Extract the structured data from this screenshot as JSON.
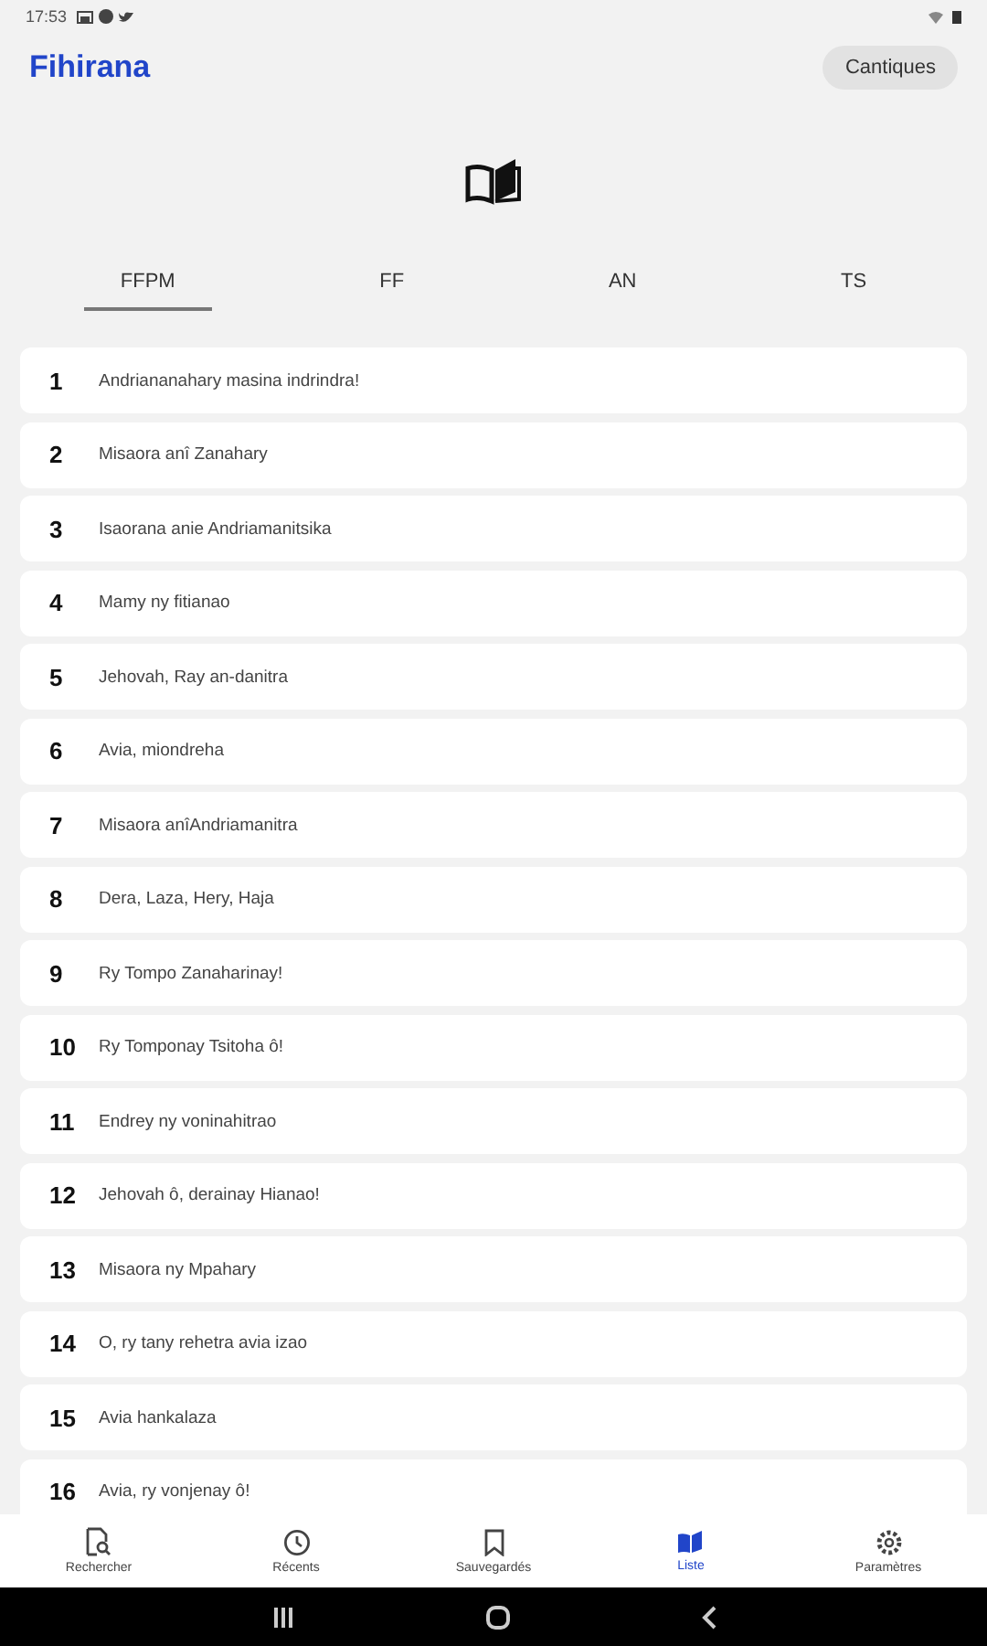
{
  "status_bar": {
    "time": "17:53"
  },
  "header": {
    "title": "Fihirana",
    "button": "Cantiques"
  },
  "tabs": [
    {
      "label": "FFPM",
      "selected": true
    },
    {
      "label": "FF",
      "selected": false
    },
    {
      "label": "AN",
      "selected": false
    },
    {
      "label": "TS",
      "selected": false
    }
  ],
  "hymns": [
    {
      "number": "1",
      "title": "Andriananahary masina indrindra!"
    },
    {
      "number": "2",
      "title": "Misaora anî Zanahary"
    },
    {
      "number": "3",
      "title": "Isaorana anie Andriamanitsika"
    },
    {
      "number": "4",
      "title": "Mamy ny fitianao"
    },
    {
      "number": "5",
      "title": "Jehovah, Ray an-danitra"
    },
    {
      "number": "6",
      "title": "Avia, miondreha"
    },
    {
      "number": "7",
      "title": "Misaora anîAndriamanitra"
    },
    {
      "number": "8",
      "title": "Dera, Laza, Hery, Haja"
    },
    {
      "number": "9",
      "title": "Ry Tompo Zanaharinay!"
    },
    {
      "number": "10",
      "title": "Ry Tomponay Tsitoha ô!"
    },
    {
      "number": "11",
      "title": "Endrey ny voninahitrao"
    },
    {
      "number": "12",
      "title": "Jehovah ô, derainay Hianao!"
    },
    {
      "number": "13",
      "title": "Misaora ny Mpahary"
    },
    {
      "number": "14",
      "title": "O, ry tany rehetra avia izao"
    },
    {
      "number": "15",
      "title": "Avia hankalaza"
    },
    {
      "number": "16",
      "title": "Avia, ry vonjenay ô!"
    }
  ],
  "bottom_nav": [
    {
      "label": "Rechercher",
      "kind": "search",
      "selected": false
    },
    {
      "label": "Récents",
      "kind": "recent",
      "selected": false
    },
    {
      "label": "Sauvegardés",
      "kind": "saved",
      "selected": false
    },
    {
      "label": "Liste",
      "kind": "list",
      "selected": true
    },
    {
      "label": "Paramètres",
      "kind": "settings",
      "selected": false
    }
  ]
}
